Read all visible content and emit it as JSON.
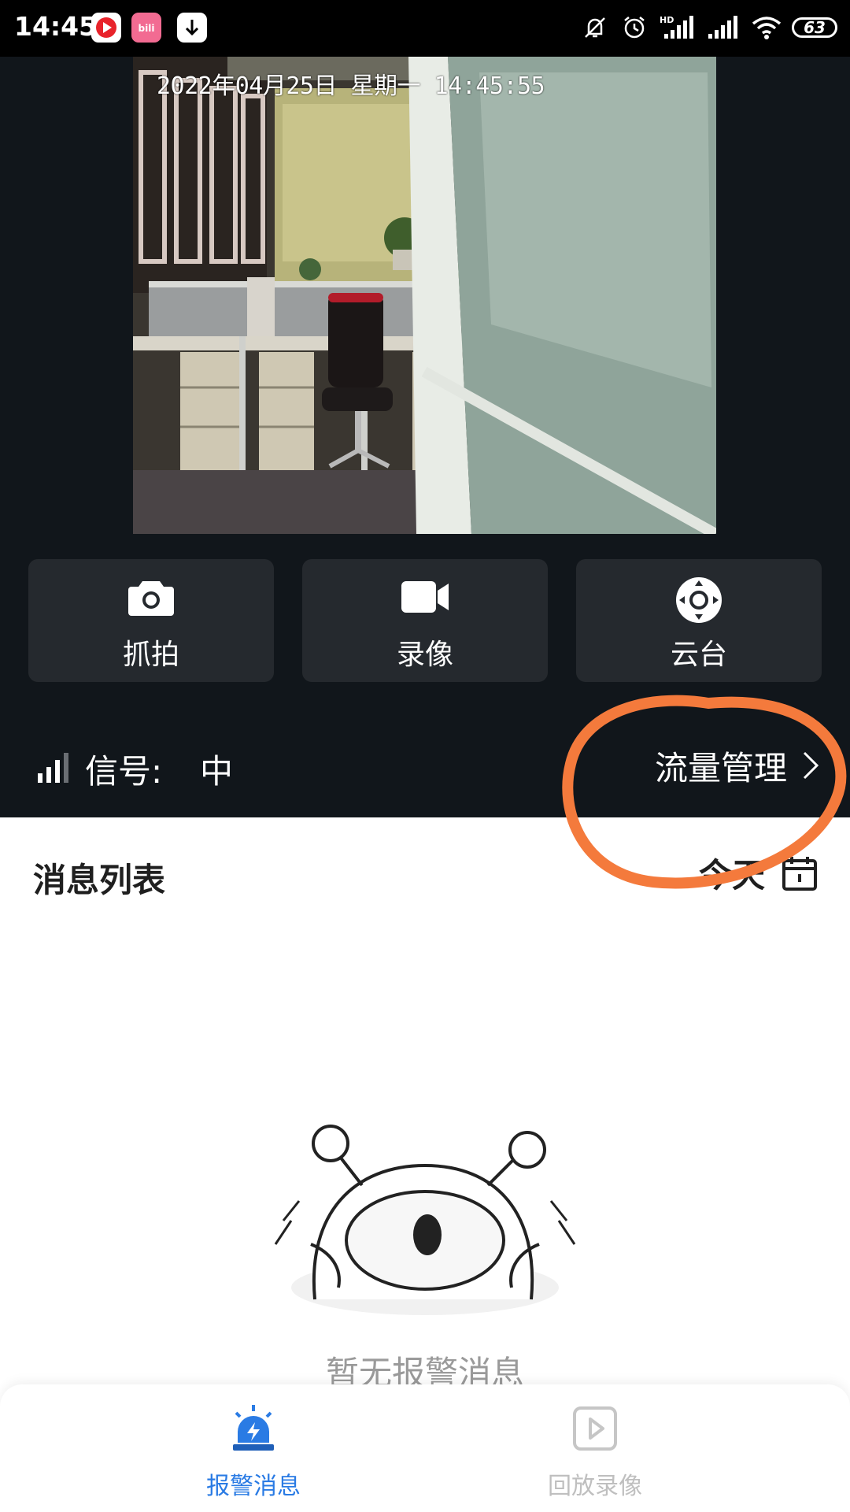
{
  "status_bar": {
    "time": "14:45",
    "battery": "63",
    "icons": [
      "youtube-music-icon",
      "bilibili-icon",
      "download-icon",
      "mute-icon",
      "alarm-icon",
      "hd-signal-icon",
      "signal-icon",
      "wifi-icon",
      "battery-icon"
    ]
  },
  "video": {
    "timestamp": "2022年04月25日  星期一  14:45:55"
  },
  "controls": [
    {
      "label": "抓拍",
      "icon": "camera-icon"
    },
    {
      "label": "录像",
      "icon": "video-camera-icon"
    },
    {
      "label": "云台",
      "icon": "ptz-control-icon"
    }
  ],
  "signal": {
    "label": "信号:",
    "value": "中",
    "icon": "signal-strength-icon"
  },
  "traffic": {
    "label": "流量管理",
    "icon": "chevron-right-icon"
  },
  "messages": {
    "title": "消息列表",
    "filter_label": "今天",
    "filter_icon": "calendar-icon",
    "empty_text": "暂无报警消息"
  },
  "bottom_nav": [
    {
      "label": "报警消息",
      "icon": "alarm-siren-icon",
      "active": true
    },
    {
      "label": "回放录像",
      "icon": "playback-icon",
      "active": false
    }
  ],
  "colors": {
    "dark_bg": "#11161b",
    "button_bg": "#25292e",
    "accent": "#2a7be4",
    "annotation": "#f47a3c"
  }
}
